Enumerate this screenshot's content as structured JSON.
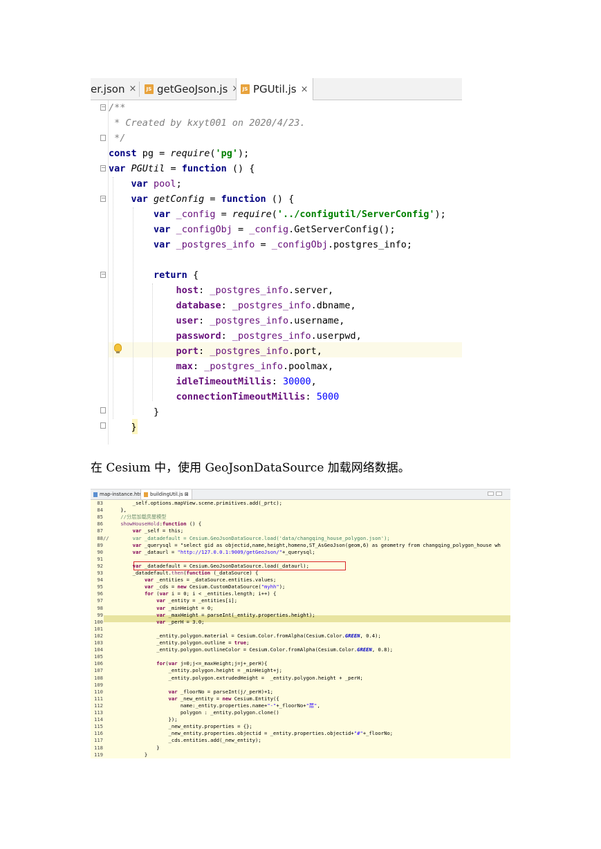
{
  "screenshot1": {
    "tabs": [
      {
        "label": "er.json",
        "close": "×"
      },
      {
        "label": "getGeoJson.js",
        "close": "×",
        "icon": "JS"
      },
      {
        "label": "PGUtil.js",
        "close": "×",
        "icon": "JS",
        "active": true
      }
    ],
    "code_lines": [
      "/**",
      " * Created by kxyt001 on 2020/4/23.",
      " */",
      "const pg = require('pg');",
      "var PGUtil = function () {",
      "    var pool;",
      "    var getConfig = function () {",
      "        var _config = require('../configutil/ServerConfig');",
      "        var _configObj = _config.GetServerConfig();",
      "        var _postgres_info = _configObj.postgres_info;",
      "",
      "        return {",
      "            host: _postgres_info.server,",
      "            database: _postgres_info.dbname,",
      "            user: _postgres_info.username,",
      "            password: _postgres_info.userpwd,",
      "            port: _postgres_info.port,",
      "            max: _postgres_info.poolmax,",
      "            idleTimeoutMillis: 30000,",
      "            connectionTimeoutMillis: 5000",
      "        }",
      "    }"
    ]
  },
  "caption": "在 Cesium 中，使用 GeoJsonDataSource 加载网络数据。",
  "screenshot2": {
    "tabs": [
      {
        "label": "map-instance.html"
      },
      {
        "label": "buildingUtil.js ⊠",
        "active": true
      }
    ],
    "line_numbers": [
      "83",
      "84",
      "85",
      "86",
      "87",
      "88",
      "89",
      "90",
      "91",
      "92",
      "93",
      "94",
      "95",
      "96",
      "97",
      "98",
      "99",
      "100",
      "101",
      "102",
      "103",
      "104",
      "105",
      "106",
      "107",
      "108",
      "109",
      "110",
      "111",
      "112",
      "113",
      "114",
      "115",
      "116",
      "117",
      "118",
      "119"
    ],
    "code_lines": [
      "        _self.options.mapView.scene.primitives.add(_prtc);",
      "    },",
      "    //分层加载房屋模型",
      "    showHouseHold:function () {",
      "        var _self = this;",
      "        var _datadefault = Cesium.GeoJsonDataSource.load('data/changqing_house_polygon.json');",
      "        var _querysql = \"select gid as objectid,name,height,homeno,ST_AsGeoJson(geom,6) as geometry from changqing_polygon_house wh",
      "        var _dataurl = \"http://127.0.0.1:9009/getGeoJson/\"+_querysql;",
      "",
      "        var _datadefault = Cesium.GeoJsonDataSource.load(_dataurl);",
      "        _datadefault.then(function (_dataSource) {",
      "            var _entities = _dataSource.entities.values;",
      "            var _cds = new Cesium.CustomDataSource(\"myhh\");",
      "            for (var i = 0; i < _entities.length; i++) {",
      "                var _entity = _entities[i];",
      "                var _minHeight = 0;",
      "                var _maxHeight = parseInt(_entity.properties.height);",
      "                var _perH = 3.0;",
      "",
      "                _entity.polygon.material = Cesium.Color.fromAlpha(Cesium.Color.GREEN, 0.4);",
      "                _entity.polygon.outline = true;",
      "                _entity.polygon.outlineColor = Cesium.Color.fromAlpha(Cesium.Color.GREEN, 0.8);",
      "",
      "                for(var j=0;j<=_maxHeight;j=j+_perH){",
      "                    _entity.polygon.height = _minHeight+j;",
      "                    _entity.polygon.extrudedHeight =  _entity.polygon.height + _perH;",
      "",
      "                    var _floorNo = parseInt(j/_perH)+1;",
      "                    var _new_entity = new Cesium.Entity({",
      "                        name:_entity.properties.name+\"-\"+_floorNo+\"层\",",
      "                        polygon : _entity.polygon.clone()",
      "                    });",
      "                    _new_entity.properties = {};",
      "                    _new_entity.properties.objectid = _entity.properties.objectid+\"#\"+_floorNo;",
      "                    _cds.entities.add(_new_entity);",
      "                }",
      "            }"
    ],
    "line_markers": {
      "88": "//"
    },
    "highlighted_line": "98",
    "boxed_line": "92"
  },
  "colors": {
    "ij_keyword": "#000080",
    "ij_string": "#008000",
    "ij_property": "#660e7a",
    "ij_number": "#0000ff",
    "eclipse_background": "#fffde0",
    "eclipse_highlight": "#e8e4a0",
    "box_red": "#d8262a"
  }
}
